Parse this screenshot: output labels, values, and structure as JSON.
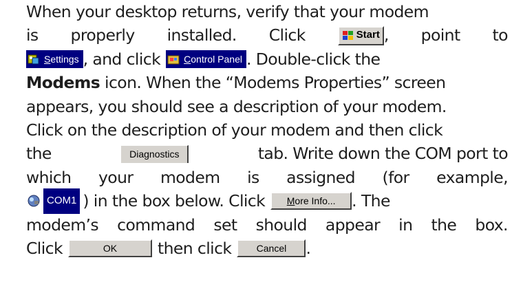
{
  "lines": {
    "l1": {
      "text": "When your desktop returns, verify that your modem"
    },
    "l2": {
      "words": [
        "is",
        "properly",
        "installed.",
        "Click"
      ],
      "after": ",",
      "tail": [
        "point",
        "to"
      ]
    },
    "l3": {
      "between": ", and click",
      "after": ". Double-click the"
    },
    "l4": {
      "bold": "Modems",
      "rest": " icon. When the “Modems Properties” screen"
    },
    "l5": {
      "text": "appears, you should see a description of your modem."
    },
    "l6": {
      "text": "Click on the description of your modem and then click"
    },
    "l7": {
      "before": "the",
      "after": "tab. Write down the COM port to"
    },
    "l8": {
      "words": [
        "which",
        "your",
        "modem",
        "is",
        "assigned",
        "(for",
        "example,"
      ]
    },
    "l9": {
      "after": ") in the box below. Click",
      "end": ". The"
    },
    "l10": {
      "words": [
        "modem’s",
        "command",
        "set",
        "should",
        "appear",
        "in",
        "the",
        "box."
      ]
    },
    "l11": {
      "before": "Click",
      "middle": "then click",
      "end": "."
    }
  },
  "ui": {
    "start_button": {
      "label": "Start",
      "icon": "windows-logo-icon"
    },
    "settings_menu": {
      "label": "Settings",
      "underline": "S",
      "rest": "ettings",
      "icon": "settings-icon"
    },
    "control_panel_menu": {
      "label": "Control Panel",
      "underline": "C",
      "rest": "ontrol Panel",
      "icon": "control-panel-icon"
    },
    "diagnostics_tab": {
      "label": "Diagnostics"
    },
    "com1_item": {
      "label": "COM1",
      "icon": "modem-port-icon"
    },
    "more_info_button": {
      "label": "More Info...",
      "underline": "M",
      "rest": "ore Info..."
    },
    "ok_button": {
      "label": "OK"
    },
    "cancel_button": {
      "label": "Cancel"
    }
  },
  "colors": {
    "text": "#1e1e1e",
    "highlight": "#000080",
    "button_face": "#d6d3ce"
  }
}
